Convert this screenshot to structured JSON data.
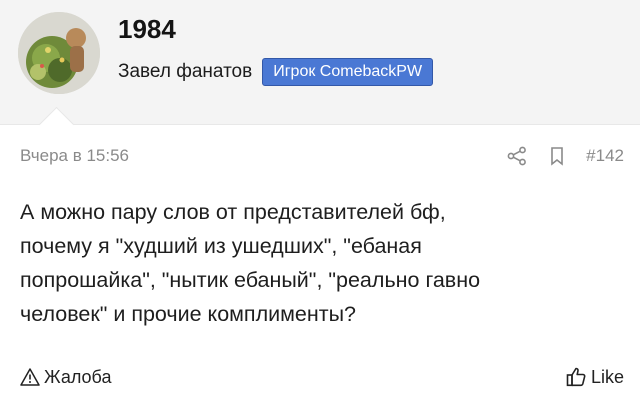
{
  "user": {
    "name": "1984",
    "role": "Завел фанатов",
    "badge": "Игрок ComebackPW"
  },
  "post": {
    "timestamp": "Вчера в 15:56",
    "number": "#142",
    "message": "А можно пару слов от представителей бф,\nпочему я \"худший из ушедших\", \"ебаная\nпопрошайка\", \"нытик ебаный\", \"реально гавно\nчеловек\" и прочие комплименты?",
    "icons": {
      "share": "share-icon",
      "bookmark": "bookmark-icon"
    }
  },
  "footer": {
    "report_label": "Жалоба",
    "like_label": "Like",
    "icons": {
      "report": "warning-icon",
      "like": "thumbs-up-icon"
    }
  },
  "colors": {
    "header_bg": "#f4f4f4",
    "badge_bg": "#4a78d4",
    "meta_text": "#8a8a8a"
  }
}
